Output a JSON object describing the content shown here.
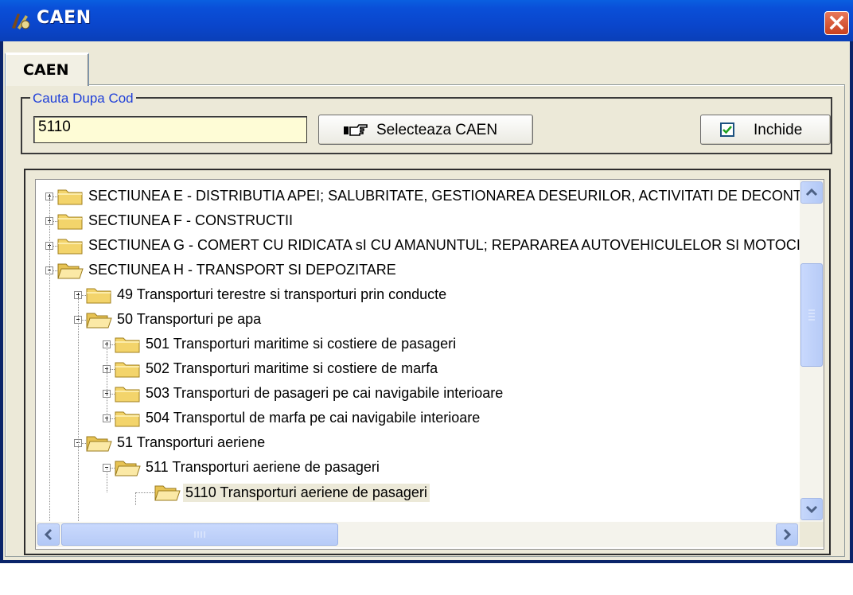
{
  "window": {
    "title": "CAEN",
    "close_label": "×"
  },
  "tabs": [
    {
      "label": "CAEN"
    }
  ],
  "search": {
    "group_label": "Cauta Dupa Cod",
    "value": "5110"
  },
  "buttons": {
    "select_label": "Selecteaza CAEN",
    "inchide_label": "Inchide",
    "inchide_checked": true
  },
  "tree": {
    "nodes": [
      {
        "label": "SECTIUNEA E -  DISTRIBUTIA APEI;  SALUBRITATE, GESTIONAREA DESEURILOR, ACTIVITATI DE DECONTAMINARE",
        "expander": "plus",
        "open": false
      },
      {
        "label": "SECTIUNEA F - CONSTRUCTII",
        "expander": "plus",
        "open": false
      },
      {
        "label": "SECTIUNEA G - COMERT CU RIDICATA sI CU AMANUNTUL; REPARAREA AUTOVEHICULELOR SI MOTOCICLETELOR",
        "expander": "plus",
        "open": false
      },
      {
        "label": "SECTIUNEA H - TRANSPORT SI DEPOZITARE",
        "expander": "minus",
        "open": true
      },
      {
        "label": "49 Transporturi terestre si transporturi prin conducte",
        "expander": "plus",
        "open": false
      },
      {
        "label": "50 Transporturi pe apa",
        "expander": "minus",
        "open": true
      },
      {
        "label": "501 Transporturi maritime si costiere de pasageri",
        "expander": "plus",
        "open": false
      },
      {
        "label": "502 Transporturi maritime si costiere de marfa",
        "expander": "plus",
        "open": false
      },
      {
        "label": "503 Transporturi de pasageri pe cai navigabile interioare",
        "expander": "plus",
        "open": false
      },
      {
        "label": "504 Transportul de marfa pe cai navigabile interioare",
        "expander": "plus",
        "open": false
      },
      {
        "label": "51 Transporturi aeriene",
        "expander": "minus",
        "open": true
      },
      {
        "label": "511 Transporturi aeriene de pasageri",
        "expander": "minus",
        "open": true
      },
      {
        "label": "5110 Transporturi aeriene de pasageri",
        "expander": "none",
        "open": true,
        "selected": true
      }
    ]
  }
}
